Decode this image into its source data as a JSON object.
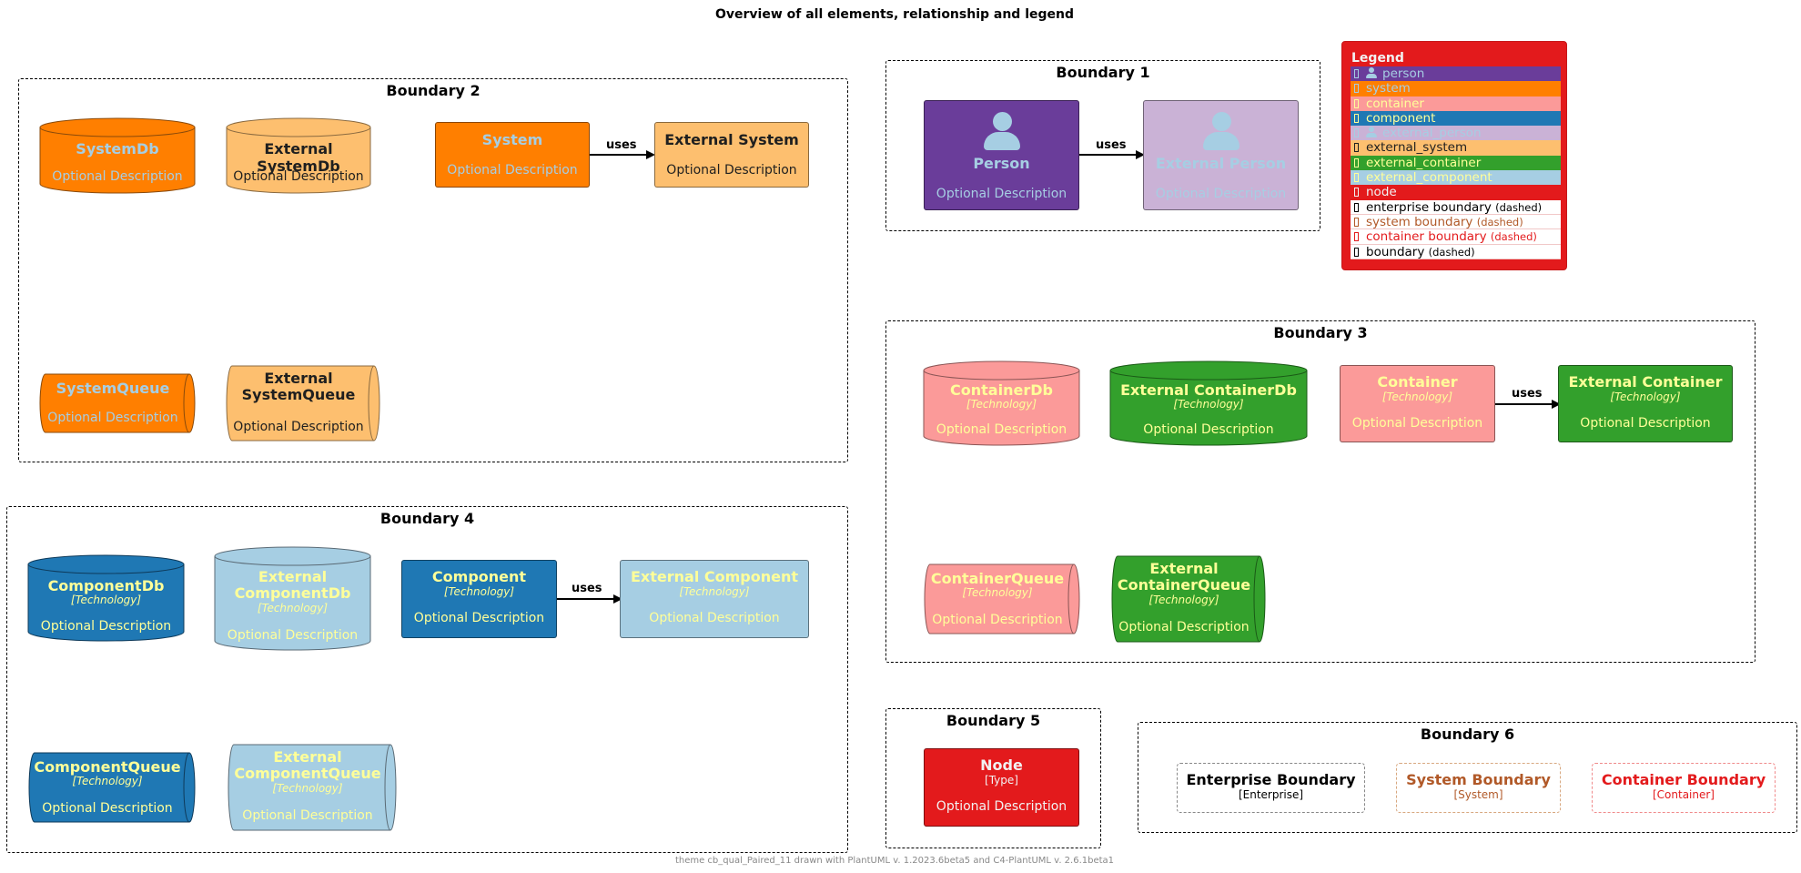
{
  "title": "Overview of all elements, relationship and legend",
  "footer": "theme cb_qual_Paired_11 drawn with PlantUML v. 1.2023.6beta5 and C4-PlantUML v. 2.6.1beta1",
  "colors": {
    "person": "#6a3d9a",
    "person_text": "#a6cee3",
    "external_person": "#cab2d6",
    "external_person_text": "#a6cee3",
    "system": "#ff7f00",
    "system_text": "#a6cee3",
    "external_system": "#fdbf6f",
    "external_system_text": "#1f1f1f",
    "container": "#fb9a99",
    "container_text": "#ffff99",
    "external_container": "#33a02c",
    "external_container_text": "#ffff99",
    "component": "#1f78b4",
    "component_text": "#ffff99",
    "external_component": "#a6cee3",
    "external_component_text": "#ffff99",
    "node": "#e31a1c",
    "node_text": "#f2f2f2",
    "enterprise_boundary": "#000000",
    "system_boundary": "#b15928",
    "container_boundary": "#e31a1c"
  },
  "boundaries": {
    "b1": {
      "label": "Boundary 1"
    },
    "b2": {
      "label": "Boundary 2"
    },
    "b3": {
      "label": "Boundary 3"
    },
    "b4": {
      "label": "Boundary 4"
    },
    "b5": {
      "label": "Boundary 5"
    },
    "b6": {
      "label": "Boundary 6"
    }
  },
  "elements": {
    "person": {
      "name": "Person",
      "description": "Optional Description",
      "icon": "person-icon"
    },
    "external_person": {
      "name": "External Person",
      "description": "Optional Description",
      "icon": "person-icon"
    },
    "system_db": {
      "name": "SystemDb",
      "description": "Optional Description"
    },
    "external_system_db": {
      "name": "External SystemDb",
      "description": "Optional Description"
    },
    "system": {
      "name": "System",
      "description": "Optional Description"
    },
    "external_system": {
      "name": "External System",
      "description": "Optional Description"
    },
    "system_queue": {
      "name": "SystemQueue",
      "description": "Optional Description"
    },
    "external_system_queue": {
      "name_line1": "External",
      "name_line2": "SystemQueue",
      "description": "Optional Description"
    },
    "container_db": {
      "name": "ContainerDb",
      "technology": "[Technology]",
      "description": "Optional Description"
    },
    "external_container_db": {
      "name": "External ContainerDb",
      "technology": "[Technology]",
      "description": "Optional Description"
    },
    "container": {
      "name": "Container",
      "technology": "[Technology]",
      "description": "Optional Description"
    },
    "external_container": {
      "name": "External Container",
      "technology": "[Technology]",
      "description": "Optional Description"
    },
    "container_queue": {
      "name": "ContainerQueue",
      "technology": "[Technology]",
      "description": "Optional Description"
    },
    "external_container_queue": {
      "name_line1": "External",
      "name_line2": "ContainerQueue",
      "technology": "[Technology]",
      "description": "Optional Description"
    },
    "component_db": {
      "name": "ComponentDb",
      "technology": "[Technology]",
      "description": "Optional Description"
    },
    "external_component_db": {
      "name_line1": "External",
      "name_line2": "ComponentDb",
      "technology": "[Technology]",
      "description": "Optional Description"
    },
    "component": {
      "name": "Component",
      "technology": "[Technology]",
      "description": "Optional Description"
    },
    "external_component": {
      "name": "External Component",
      "technology": "[Technology]",
      "description": "Optional Description"
    },
    "component_queue": {
      "name": "ComponentQueue",
      "technology": "[Technology]",
      "description": "Optional Description"
    },
    "external_component_queue": {
      "name_line1": "External",
      "name_line2": "ComponentQueue",
      "technology": "[Technology]",
      "description": "Optional Description"
    },
    "node": {
      "name": "Node",
      "type": "[Type]",
      "description": "Optional Description"
    },
    "enterprise_boundary": {
      "name": "Enterprise Boundary",
      "type": "[Enterprise]"
    },
    "system_boundary": {
      "name": "System Boundary",
      "type": "[System]"
    },
    "container_boundary": {
      "name": "Container Boundary",
      "type": "[Container]"
    }
  },
  "relationships": [
    {
      "from": "Person",
      "to": "External Person",
      "label": "uses"
    },
    {
      "from": "System",
      "to": "External System",
      "label": "uses"
    },
    {
      "from": "Container",
      "to": "External Container",
      "label": "uses"
    },
    {
      "from": "Component",
      "to": "External Component",
      "label": "uses"
    }
  ],
  "legend": {
    "title": "Legend",
    "items": [
      {
        "label": "person",
        "bg": "#6a3d9a",
        "fg": "#a6cee3",
        "icon": "person-icon"
      },
      {
        "label": "system",
        "bg": "#ff7f00",
        "fg": "#a6cee3"
      },
      {
        "label": "container",
        "bg": "#fb9a99",
        "fg": "#ffff99"
      },
      {
        "label": "component",
        "bg": "#1f78b4",
        "fg": "#ffff99"
      },
      {
        "label": "external_person",
        "bg": "#cab2d6",
        "fg": "#a6cee3",
        "icon": "person-icon"
      },
      {
        "label": "external_system",
        "bg": "#fdbf6f",
        "fg": "#1f1f1f"
      },
      {
        "label": "external_container",
        "bg": "#33a02c",
        "fg": "#ffff99"
      },
      {
        "label": "external_component",
        "bg": "#a6cee3",
        "fg": "#ffff99"
      },
      {
        "label": "node",
        "bg": "#e31a1c",
        "fg": "#f2f2f2"
      },
      {
        "label": "enterprise boundary",
        "suffix": "(dashed)",
        "bg": "#ffffff",
        "fg": "#000000"
      },
      {
        "label": "system boundary",
        "suffix": "(dashed)",
        "bg": "#ffffff",
        "fg": "#b15928"
      },
      {
        "label": "container boundary",
        "suffix": "(dashed)",
        "bg": "#ffffff",
        "fg": "#e31a1c"
      },
      {
        "label": "boundary",
        "suffix": "(dashed)",
        "bg": "#ffffff",
        "fg": "#000000"
      }
    ]
  }
}
